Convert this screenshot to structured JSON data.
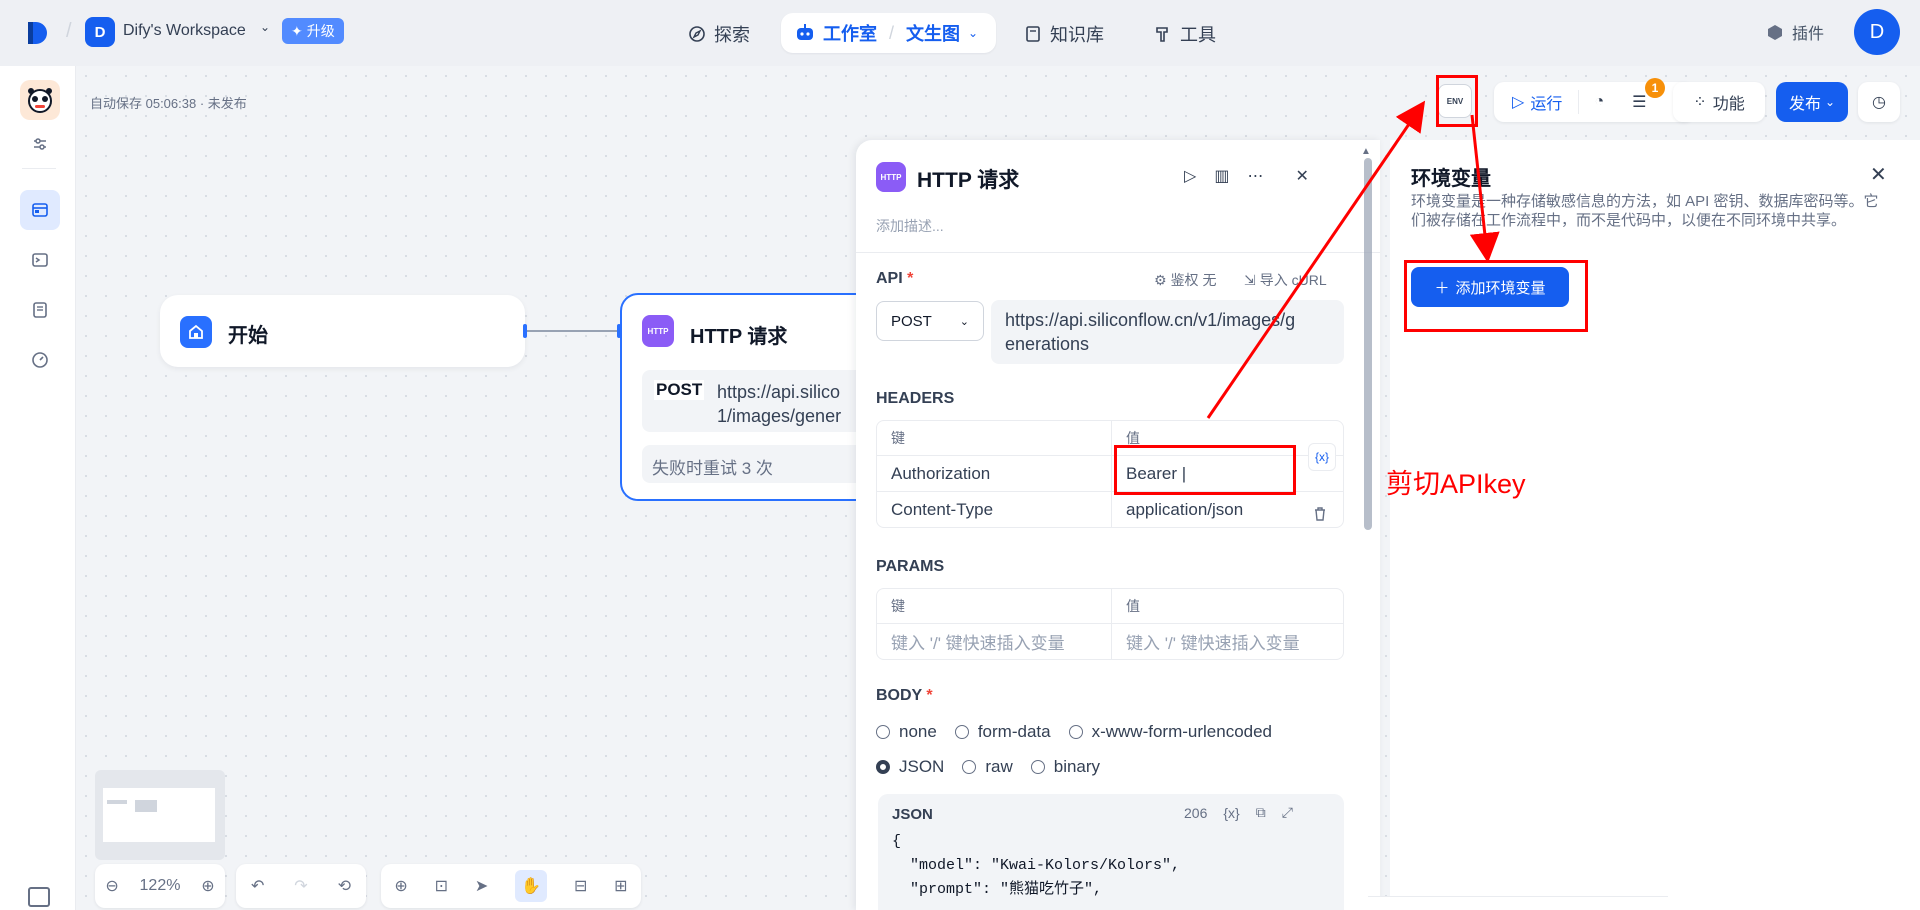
{
  "topbar": {
    "workspace_initial": "D",
    "workspace_name": "Dify's Workspace",
    "upgrade_label": "升级",
    "nav": {
      "explore": "探索",
      "studio": "工作室",
      "app_name": "文生图",
      "knowledge": "知识库",
      "tools": "工具"
    },
    "plugins": "插件",
    "user_initial": "D"
  },
  "canvas": {
    "autosave": "自动保存 05:06:38 · 未发布",
    "start_node": "开始",
    "http_node": {
      "title": "HTTP 请求",
      "method": "POST",
      "url": "https://api.silico\n1/images/gener",
      "retry": "失败时重试 3 次"
    },
    "zoom": "122%"
  },
  "toolbar": {
    "env_label": "ENV",
    "run": "运行",
    "badge_count": "1",
    "features": "功能",
    "publish": "发布"
  },
  "panel": {
    "title": "HTTP 请求",
    "description_placeholder": "添加描述...",
    "api_label": "API",
    "required_mark": "*",
    "auth_label": "鉴权 无",
    "import_curl": "导入 cURL",
    "method": "POST",
    "url": "https://api.siliconflow.cn/v1/images/g\nenerations",
    "headers_label": "HEADERS",
    "headers_cols": [
      "键",
      "值"
    ],
    "headers": [
      {
        "key": "Authorization",
        "value": "Bearer |"
      },
      {
        "key": "Content-Type",
        "value": "application/json"
      }
    ],
    "var_chip": "{x}",
    "params_label": "PARAMS",
    "params_cols": [
      "键",
      "值"
    ],
    "params_placeholder_key": "键入 '/' 键快速插入变量",
    "params_placeholder_value": "键入 '/' 键快速插入变量",
    "body_label": "BODY",
    "body_types_row1": [
      "none",
      "form-data",
      "x-www-form-urlencoded"
    ],
    "body_types_row2": [
      "JSON",
      "raw",
      "binary"
    ],
    "body_selected": "JSON",
    "json_label": "JSON",
    "json_count": "206",
    "json_code": "{\n  \"model\": \"Kwai-Kolors/Kolors\",\n  \"prompt\": \"熊猫吃竹子\","
  },
  "env_panel": {
    "title": "环境变量",
    "description": "环境变量是一种存储敏感信息的方法，如 API 密钥、数据库密码等。它们被存储在工作流程中，而不是代码中，以便在不同环境中共享。",
    "add_button": "添加环境变量"
  },
  "annotation": {
    "text": "剪切APIkey",
    "color": "#ff0000"
  },
  "colors": {
    "primary": "#155eef",
    "http_node": "#8b5cf6",
    "badge": "#f79009"
  }
}
